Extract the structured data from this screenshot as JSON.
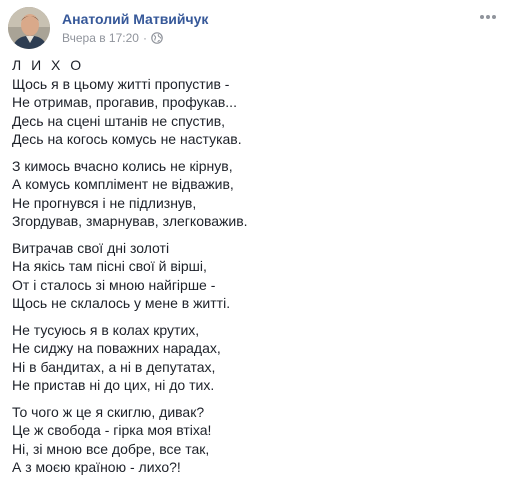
{
  "post": {
    "author": "Анатолий Матвийчук",
    "timestamp": "Вчера в 17:20",
    "separator": "·",
    "privacy_icon": "globe-icon",
    "menu_icon": "more-options-icon",
    "colors": {
      "author": "#365899",
      "meta": "#90949c",
      "text": "#1d2129"
    }
  },
  "poem": {
    "title": "Л И Х О",
    "stanzas": [
      {
        "lines": [
          "Щось я в цьому житті пропустив -",
          "Не отримав, прогавив, профукав...",
          "Десь на сцені штанів не спустив,",
          "Десь на когось комусь не настукав."
        ]
      },
      {
        "lines": [
          "З кимось вчасно колись не кірнув,",
          "А комусь комплімент не відважив,",
          "Не прогнувся і не підлизнув,",
          "Згордував, змарнував, злегковажив."
        ]
      },
      {
        "lines": [
          "Витрачав свої дні золоті",
          "На якісь там пісні свої й вірші,",
          "От і сталось зі мною найгірше -",
          "Щось не склалось у мене в житті."
        ]
      },
      {
        "lines": [
          "Не тусуюсь я в колах крутих,",
          "Не сиджу на поважних нарадах,",
          "Ні в бандитах, а ні в депутатах,",
          "Не пристав ні до цих, ні до тих."
        ]
      },
      {
        "lines": [
          "То чого ж це я скиглю, дивак?",
          "Це ж свобода - гірка моя втіха!",
          "Ні, зі мною все добре, все так,",
          "А з моєю країною - лихо?!"
        ]
      }
    ]
  }
}
